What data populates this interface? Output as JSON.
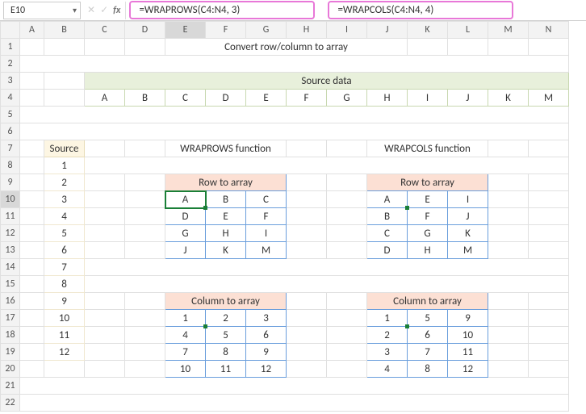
{
  "cell_ref": "E10",
  "formula1": "=WRAPROWS(C4:N4, 3)",
  "formula2": "=WRAPCOLS(C4:N4, 4)",
  "columns": [
    "A",
    "B",
    "C",
    "D",
    "E",
    "F",
    "G",
    "H",
    "I",
    "J",
    "K",
    "L",
    "M",
    "N"
  ],
  "rows": [
    "1",
    "2",
    "3",
    "4",
    "5",
    "6",
    "7",
    "8",
    "9",
    "10",
    "11",
    "12",
    "13",
    "14",
    "15",
    "16",
    "17",
    "18",
    "19",
    "20",
    "21",
    "22"
  ],
  "title": "Convert row/column to array",
  "source_data_hdr": "Source data",
  "source_row": [
    "A",
    "B",
    "C",
    "D",
    "E",
    "F",
    "G",
    "H",
    "I",
    "J",
    "K",
    "M"
  ],
  "source_col_hdr": "Source",
  "source_col": [
    "1",
    "2",
    "3",
    "4",
    "5",
    "6",
    "7",
    "8",
    "9",
    "10",
    "11",
    "12"
  ],
  "wraprows_title": "WRAPROWS function",
  "wrapcols_title": "WRAPCOLS function",
  "row_to_array": "Row to array",
  "col_to_array": "Column to array",
  "wr_row": [
    [
      "A",
      "B",
      "C"
    ],
    [
      "D",
      "E",
      "F"
    ],
    [
      "G",
      "H",
      "I"
    ],
    [
      "J",
      "K",
      "M"
    ]
  ],
  "wc_row": [
    [
      "A",
      "E",
      "I"
    ],
    [
      "B",
      "F",
      "J"
    ],
    [
      "C",
      "G",
      "K"
    ],
    [
      "D",
      "H",
      "M"
    ]
  ],
  "wr_col": [
    [
      "1",
      "2",
      "3"
    ],
    [
      "4",
      "5",
      "6"
    ],
    [
      "7",
      "8",
      "9"
    ],
    [
      "10",
      "11",
      "12"
    ]
  ],
  "wc_col": [
    [
      "1",
      "5",
      "9"
    ],
    [
      "2",
      "6",
      "10"
    ],
    [
      "3",
      "7",
      "11"
    ],
    [
      "4",
      "8",
      "12"
    ]
  ],
  "chart_data": {
    "type": "table",
    "title": "Convert row/column to array",
    "source_row": [
      "A",
      "B",
      "C",
      "D",
      "E",
      "F",
      "G",
      "H",
      "I",
      "J",
      "K",
      "M"
    ],
    "source_column": [
      1,
      2,
      3,
      4,
      5,
      6,
      7,
      8,
      9,
      10,
      11,
      12
    ],
    "wraprows_row_to_array": [
      [
        "A",
        "B",
        "C"
      ],
      [
        "D",
        "E",
        "F"
      ],
      [
        "G",
        "H",
        "I"
      ],
      [
        "J",
        "K",
        "M"
      ]
    ],
    "wrapcols_row_to_array": [
      [
        "A",
        "E",
        "I"
      ],
      [
        "B",
        "F",
        "J"
      ],
      [
        "C",
        "G",
        "K"
      ],
      [
        "D",
        "H",
        "M"
      ]
    ],
    "wraprows_column_to_array": [
      [
        1,
        2,
        3
      ],
      [
        4,
        5,
        6
      ],
      [
        7,
        8,
        9
      ],
      [
        10,
        11,
        12
      ]
    ],
    "wrapcols_column_to_array": [
      [
        1,
        5,
        9
      ],
      [
        2,
        6,
        10
      ],
      [
        3,
        7,
        11
      ],
      [
        4,
        8,
        12
      ]
    ]
  }
}
